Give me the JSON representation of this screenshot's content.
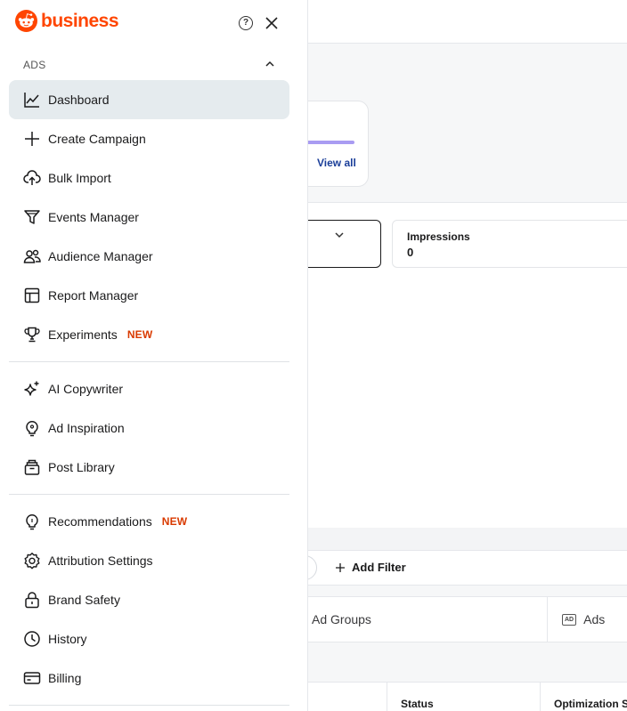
{
  "background": {
    "view_all_link": "View all",
    "metric_card": {
      "label": "Impressions",
      "value": "0"
    },
    "filter": {
      "add_filter_label": "Add Filter"
    },
    "tabs": {
      "ad_groups": "Ad Groups",
      "ads": "Ads",
      "ads_badge": "AD"
    },
    "table_headers": {
      "status": "Status",
      "optimization": "Optimization S"
    }
  },
  "sidebar": {
    "brand": "business",
    "help_label": "?",
    "section_title": "ADS",
    "new_badge": "NEW",
    "items": [
      {
        "label": "Dashboard",
        "icon": "chart-line-icon",
        "active": true
      },
      {
        "label": "Create Campaign",
        "icon": "plus-icon"
      },
      {
        "label": "Bulk Import",
        "icon": "cloud-upload-icon"
      },
      {
        "label": "Events Manager",
        "icon": "funnel-icon"
      },
      {
        "label": "Audience Manager",
        "icon": "users-icon"
      },
      {
        "label": "Report Manager",
        "icon": "table-icon"
      },
      {
        "label": "Experiments",
        "icon": "trophy-icon",
        "badge": "NEW"
      },
      {
        "label": "AI Copywriter",
        "icon": "sparkle-icon"
      },
      {
        "label": "Ad Inspiration",
        "icon": "lightbulb-icon"
      },
      {
        "label": "Post Library",
        "icon": "archive-icon"
      },
      {
        "label": "Recommendations",
        "icon": "lightbulb-icon",
        "badge": "NEW"
      },
      {
        "label": "Attribution Settings",
        "icon": "gear-icon"
      },
      {
        "label": "Brand Safety",
        "icon": "lock-icon"
      },
      {
        "label": "History",
        "icon": "clock-icon"
      },
      {
        "label": "Billing",
        "icon": "credit-card-icon"
      }
    ]
  },
  "colors": {
    "brand": "#ff4500",
    "new_badge": "#d93a00",
    "active_bg": "#e5ebee",
    "link": "#1a3e99"
  }
}
